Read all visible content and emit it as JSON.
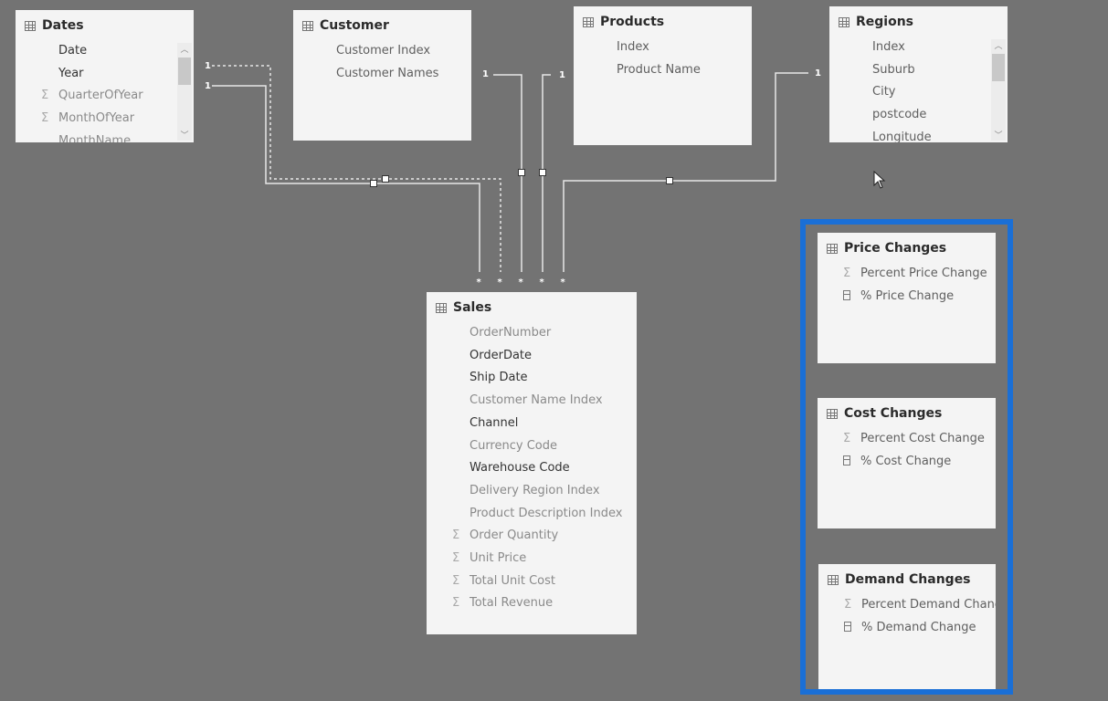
{
  "colors": {
    "background": "#737373",
    "card": "#f4f4f4",
    "highlight": "#1a6fd6",
    "line": "#e8e8e8"
  },
  "tables": [
    {
      "id": "dates",
      "name": "Dates",
      "scroll": true,
      "fields": [
        {
          "label": "Date",
          "icon": "none",
          "tone": "dark"
        },
        {
          "label": "Year",
          "icon": "none",
          "tone": "dark"
        },
        {
          "label": "QuarterOfYear",
          "icon": "sigma-icon",
          "tone": "muted"
        },
        {
          "label": "MonthOfYear",
          "icon": "sigma-icon",
          "tone": "muted"
        },
        {
          "label": "MonthName",
          "icon": "none",
          "tone": "muted"
        }
      ]
    },
    {
      "id": "customer",
      "name": "Customer",
      "fields": [
        {
          "label": "Customer Index",
          "icon": "none",
          "tone": "mid"
        },
        {
          "label": "Customer Names",
          "icon": "none",
          "tone": "mid"
        }
      ]
    },
    {
      "id": "products",
      "name": "Products",
      "fields": [
        {
          "label": "Index",
          "icon": "none",
          "tone": "mid"
        },
        {
          "label": "Product Name",
          "icon": "none",
          "tone": "mid"
        }
      ]
    },
    {
      "id": "regions",
      "name": "Regions",
      "scroll": true,
      "fields": [
        {
          "label": "Index",
          "icon": "none",
          "tone": "mid"
        },
        {
          "label": "Suburb",
          "icon": "none",
          "tone": "mid"
        },
        {
          "label": "City",
          "icon": "none",
          "tone": "mid"
        },
        {
          "label": "postcode",
          "icon": "none",
          "tone": "mid"
        },
        {
          "label": "Longitude",
          "icon": "none",
          "tone": "mid"
        }
      ]
    },
    {
      "id": "sales",
      "name": "Sales",
      "fields": [
        {
          "label": "OrderNumber",
          "icon": "none",
          "tone": "muted"
        },
        {
          "label": "OrderDate",
          "icon": "none",
          "tone": "dark"
        },
        {
          "label": "Ship Date",
          "icon": "none",
          "tone": "dark"
        },
        {
          "label": "Customer Name Index",
          "icon": "none",
          "tone": "muted"
        },
        {
          "label": "Channel",
          "icon": "none",
          "tone": "dark"
        },
        {
          "label": "Currency Code",
          "icon": "none",
          "tone": "muted"
        },
        {
          "label": "Warehouse Code",
          "icon": "none",
          "tone": "dark"
        },
        {
          "label": "Delivery Region Index",
          "icon": "none",
          "tone": "muted"
        },
        {
          "label": "Product Description Index",
          "icon": "none",
          "tone": "muted"
        },
        {
          "label": "Order Quantity",
          "icon": "sigma-icon",
          "tone": "muted"
        },
        {
          "label": "Unit Price",
          "icon": "sigma-icon",
          "tone": "muted"
        },
        {
          "label": "Total Unit Cost",
          "icon": "sigma-icon",
          "tone": "muted"
        },
        {
          "label": "Total Revenue",
          "icon": "sigma-icon",
          "tone": "muted"
        }
      ]
    },
    {
      "id": "price-changes",
      "name": "Price Changes",
      "fields": [
        {
          "label": "Percent Price Change",
          "icon": "sigma-icon",
          "tone": "mid"
        },
        {
          "label": "% Price Change",
          "icon": "calculator-icon",
          "tone": "mid"
        }
      ]
    },
    {
      "id": "cost-changes",
      "name": "Cost Changes",
      "fields": [
        {
          "label": "Percent Cost Change",
          "icon": "sigma-icon",
          "tone": "mid"
        },
        {
          "label": "% Cost Change",
          "icon": "calculator-icon",
          "tone": "mid"
        }
      ]
    },
    {
      "id": "demand-changes",
      "name": "Demand Changes",
      "fields": [
        {
          "label": "Percent Demand Chang",
          "icon": "sigma-icon",
          "tone": "mid"
        },
        {
          "label": "% Demand Change",
          "icon": "calculator-icon",
          "tone": "mid"
        }
      ]
    }
  ],
  "relationships": [
    {
      "from": "Dates",
      "to": "Sales",
      "one": "1",
      "many": "*",
      "active": true
    },
    {
      "from": "Dates",
      "to": "Sales",
      "one": "1",
      "many": "*",
      "active": false
    },
    {
      "from": "Customer",
      "to": "Sales",
      "one": "1",
      "many": "*",
      "active": true
    },
    {
      "from": "Products",
      "to": "Sales",
      "one": "1",
      "many": "*",
      "active": true
    },
    {
      "from": "Regions",
      "to": "Sales",
      "one": "1",
      "many": "*",
      "active": true
    }
  ]
}
